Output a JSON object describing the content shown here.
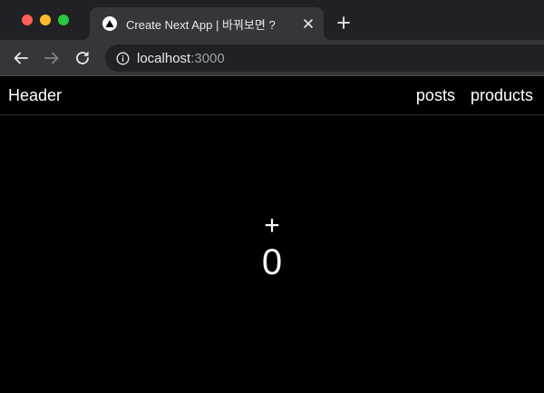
{
  "browser": {
    "tab": {
      "title": "Create Next App | 바꿔보면 ?",
      "favicon": "nextjs-triangle-icon"
    },
    "new_tab_icon": "plus-icon",
    "address": {
      "host": "localhost",
      "port": ":3000"
    },
    "colors": {
      "chrome": "#202124",
      "toolbar": "#35363a",
      "red": "#ff5f57",
      "yellow": "#febc2e",
      "green": "#28c840"
    }
  },
  "page": {
    "header": {
      "brand": "Header",
      "nav": [
        {
          "label": "posts"
        },
        {
          "label": "products"
        }
      ]
    },
    "counter": {
      "increment_label": "+",
      "value": "0"
    },
    "colors": {
      "background": "#000000",
      "text": "#ffffff"
    }
  }
}
